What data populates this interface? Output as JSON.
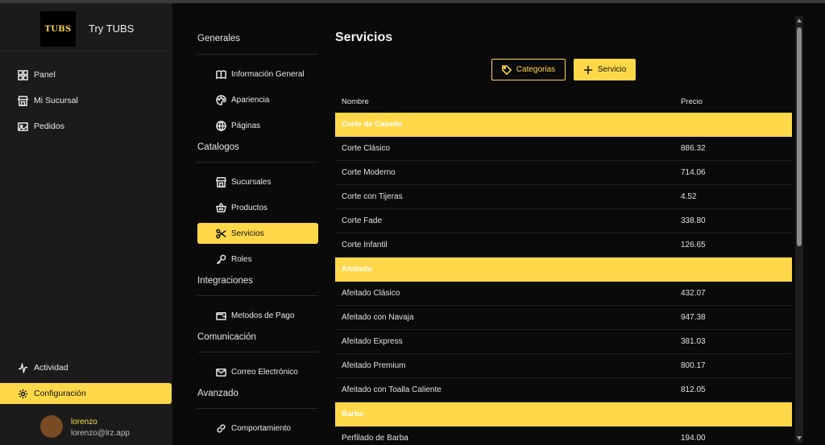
{
  "app": {
    "logo_text": "TUBS",
    "brand_name": "Try TUBS"
  },
  "sidebar": {
    "items": [
      {
        "label": "Panel",
        "icon": "grid-icon"
      },
      {
        "label": "Mi Sucursal",
        "icon": "store-icon"
      },
      {
        "label": "Pedidos",
        "icon": "image-icon"
      }
    ],
    "bottom_items": [
      {
        "label": "Actividad",
        "icon": "activity-icon"
      },
      {
        "label": "Configuración",
        "icon": "gear-icon",
        "active": true
      }
    ]
  },
  "user": {
    "name": "lorenzo",
    "email": "lorenzo@lrz.app"
  },
  "settings_menu": {
    "sections": [
      {
        "title": "Generales",
        "items": [
          {
            "label": "Información General",
            "icon": "book-icon"
          },
          {
            "label": "Apariencia",
            "icon": "palette-icon"
          },
          {
            "label": "Páginas",
            "icon": "globe-icon"
          }
        ]
      },
      {
        "title": "Catalogos",
        "items": [
          {
            "label": "Sucursales",
            "icon": "store-icon"
          },
          {
            "label": "Productos",
            "icon": "basket-icon"
          },
          {
            "label": "Servicios",
            "icon": "scissors-icon",
            "active": true
          },
          {
            "label": "Roles",
            "icon": "key-icon"
          }
        ]
      },
      {
        "title": "Integraciones",
        "items": [
          {
            "label": "Metodos de Pago",
            "icon": "wallet-icon"
          }
        ]
      },
      {
        "title": "Comunicación",
        "items": [
          {
            "label": "Correo Electrónico",
            "icon": "mail-icon"
          }
        ]
      },
      {
        "title": "Avanzado",
        "items": [
          {
            "label": "Comportamiento",
            "icon": "link-icon"
          }
        ]
      }
    ]
  },
  "main": {
    "title": "Servicios",
    "btn_categories": "Categorias",
    "btn_add": "Servicio",
    "columns": {
      "name": "Nombre",
      "price": "Precio"
    },
    "groups": [
      {
        "name": "Corte de Cabello",
        "rows": [
          {
            "name": "Corte Clásico",
            "price": "886.32"
          },
          {
            "name": "Corte Moderno",
            "price": "714.06"
          },
          {
            "name": "Corte con Tijeras",
            "price": "4.52"
          },
          {
            "name": "Corte Fade",
            "price": "338.80"
          },
          {
            "name": "Corte Infantil",
            "price": "126.65"
          }
        ]
      },
      {
        "name": "Afeitado",
        "rows": [
          {
            "name": "Afeitado Clásico",
            "price": "432.07"
          },
          {
            "name": "Afeitado con Navaja",
            "price": "947.38"
          },
          {
            "name": "Afeitado Express",
            "price": "381.03"
          },
          {
            "name": "Afeitado Premium",
            "price": "800.17"
          },
          {
            "name": "Afeitado con Toalla Caliente",
            "price": "812.05"
          }
        ]
      },
      {
        "name": "Barba",
        "rows": [
          {
            "name": "Perfilado de Barba",
            "price": "194.00"
          }
        ]
      }
    ]
  },
  "colors": {
    "accent": "#ffd84a",
    "sidebar_bg": "#1b1b1b",
    "main_bg": "#0a0a0a"
  }
}
